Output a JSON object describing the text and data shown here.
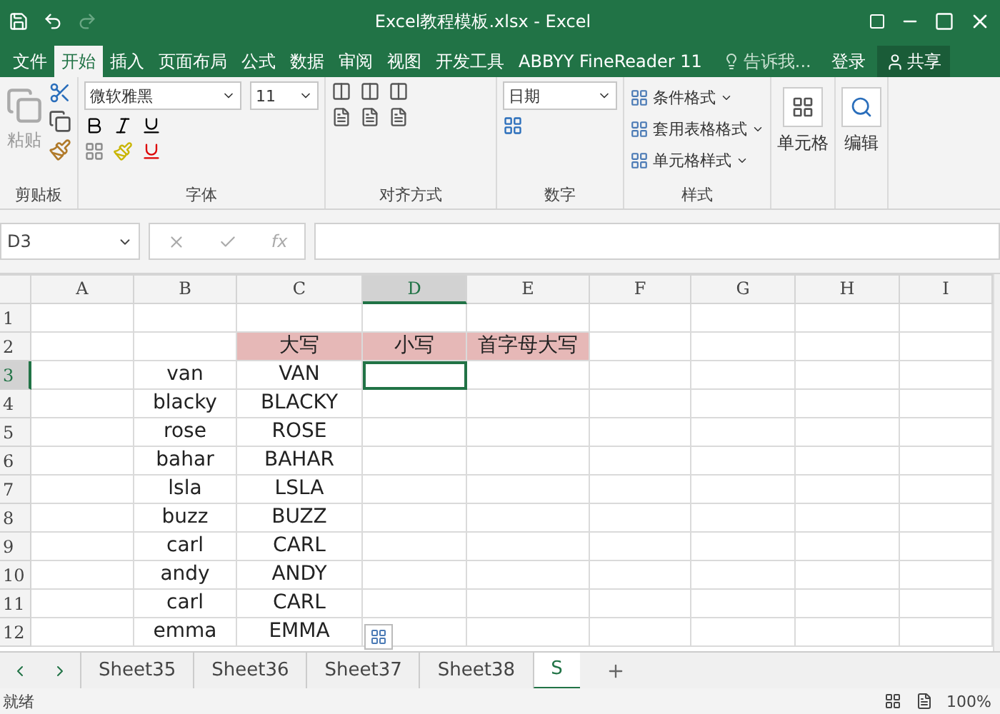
{
  "window": {
    "title": "Excel教程模板.xlsx - Excel"
  },
  "tabs": [
    {
      "label": "文件",
      "selected": false
    },
    {
      "label": "开始",
      "selected": true
    },
    {
      "label": "插入",
      "selected": false
    },
    {
      "label": "页面布局",
      "selected": false
    },
    {
      "label": "公式",
      "selected": false
    },
    {
      "label": "数据",
      "selected": false
    },
    {
      "label": "审阅",
      "selected": false
    },
    {
      "label": "视图",
      "selected": false
    },
    {
      "label": "开发工具",
      "selected": false
    },
    {
      "label": "ABBYY FineReader 11",
      "selected": false
    }
  ],
  "tell_me": {
    "placeholder": "告诉我..."
  },
  "sign_in": "登录",
  "share": "共享",
  "ribbon": {
    "clipboard": {
      "paste": "粘贴",
      "label": "剪贴板"
    },
    "font": {
      "name": "微软雅黑",
      "size": "11",
      "label": "字体"
    },
    "alignment": {
      "label": "对齐方式"
    },
    "number": {
      "format": "日期",
      "label": "数字"
    },
    "styles": {
      "items": [
        "条件格式",
        "套用表格格式",
        "单元格样式"
      ],
      "label": "样式"
    },
    "cells": "单元格",
    "editing": "编辑"
  },
  "formula_bar": {
    "name_box": "D3",
    "fx": "fx"
  },
  "columns": [
    {
      "label": "A",
      "selected": false
    },
    {
      "label": "B",
      "selected": false
    },
    {
      "label": "C",
      "selected": false
    },
    {
      "label": "D",
      "selected": true
    },
    {
      "label": "E",
      "selected": false
    },
    {
      "label": "F",
      "selected": false
    },
    {
      "label": "G",
      "selected": false
    },
    {
      "label": "H",
      "selected": false
    },
    {
      "label": "I",
      "selected": false
    }
  ],
  "rows": [
    {
      "number": "1",
      "selected": false
    },
    {
      "number": "2",
      "selected": false,
      "headers": [
        "大写",
        "小写",
        "首字母大写"
      ]
    },
    {
      "number": "3",
      "selected": true,
      "name": "van",
      "upper": "VAN"
    },
    {
      "number": "4",
      "selected": false,
      "name": "blacky",
      "upper": "BLACKY"
    },
    {
      "number": "5",
      "selected": false,
      "name": "rose",
      "upper": "ROSE"
    },
    {
      "number": "6",
      "selected": false,
      "name": "bahar",
      "upper": "BAHAR"
    },
    {
      "number": "7",
      "selected": false,
      "name": "lsla",
      "upper": "LSLA"
    },
    {
      "number": "8",
      "selected": false,
      "name": "buzz",
      "upper": "BUZZ"
    },
    {
      "number": "9",
      "selected": false,
      "name": "carl",
      "upper": "CARL"
    },
    {
      "number": "10",
      "selected": false,
      "name": "andy",
      "upper": "ANDY"
    },
    {
      "number": "11",
      "selected": false,
      "name": "carl",
      "upper": "CARL"
    },
    {
      "number": "12",
      "selected": false,
      "name": "emma",
      "upper": "EMMA"
    }
  ],
  "sheets": [
    {
      "label": "Sheet35",
      "selected": false
    },
    {
      "label": "Sheet36",
      "selected": false
    },
    {
      "label": "Sheet37",
      "selected": false
    },
    {
      "label": "Sheet38",
      "selected": false
    },
    {
      "label": "S",
      "selected": true
    }
  ],
  "status_bar": {
    "status": "就绪",
    "zoom": "100%"
  }
}
